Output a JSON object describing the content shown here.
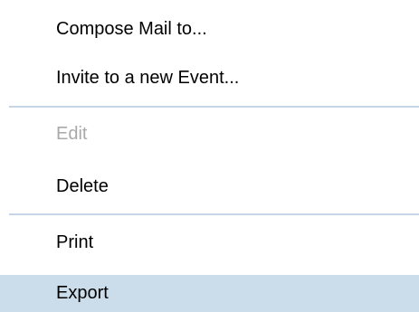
{
  "menu": {
    "items": [
      {
        "label": "Compose Mail to...",
        "enabled": true,
        "highlighted": false
      },
      {
        "label": "Invite to a new Event...",
        "enabled": true,
        "highlighted": false
      },
      {
        "label": "Edit",
        "enabled": false,
        "highlighted": false
      },
      {
        "label": "Delete",
        "enabled": true,
        "highlighted": false
      },
      {
        "label": "Print",
        "enabled": true,
        "highlighted": false
      },
      {
        "label": "Export",
        "enabled": true,
        "highlighted": true
      }
    ],
    "colors": {
      "highlight": "#cbdcea",
      "separator": "#c7d6e6",
      "disabled_text": "#a9a9a9",
      "text": "#000000"
    }
  }
}
